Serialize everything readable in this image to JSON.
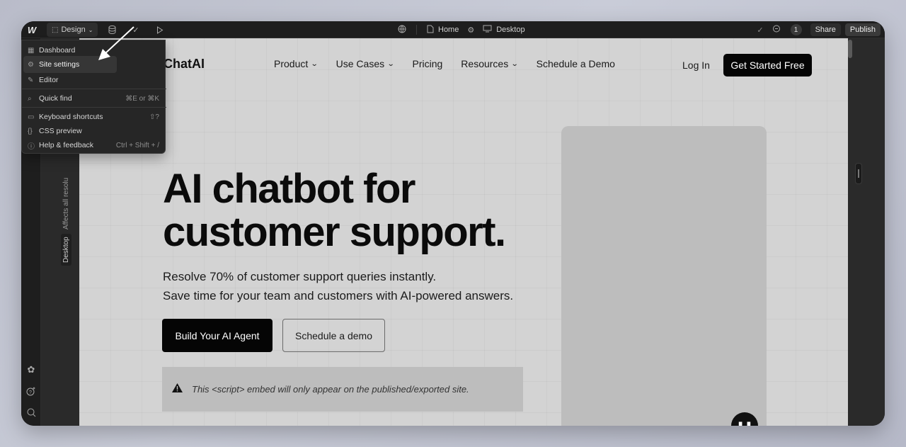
{
  "toolbar": {
    "logo": "W",
    "design_label": "Design",
    "page_label": "Home",
    "breakpoint_label": "Desktop",
    "comment_count": "1",
    "share_label": "Share",
    "publish_label": "Publish"
  },
  "menu": {
    "items": [
      {
        "label": "Dashboard",
        "icon": "grid-icon",
        "shortcut": ""
      },
      {
        "label": "Site settings",
        "icon": "gear-icon",
        "shortcut": ""
      },
      {
        "label": "Editor",
        "icon": "pencil-icon",
        "shortcut": ""
      },
      {
        "label": "Quick find",
        "icon": "search-icon",
        "shortcut": "⌘E or ⌘K"
      },
      {
        "label": "Keyboard shortcuts",
        "icon": "keyboard-icon",
        "shortcut": "⇧?"
      },
      {
        "label": "CSS preview",
        "icon": "braces-icon",
        "shortcut": ""
      },
      {
        "label": "Help & feedback",
        "icon": "help-icon",
        "shortcut": "Ctrl + Shift + /"
      }
    ]
  },
  "breakpoint_strip": {
    "affects_text": "Affects all resolu",
    "desktop_label": "Desktop"
  },
  "site": {
    "brand": "ChatAI",
    "nav": [
      {
        "label": "Product",
        "has_dropdown": true
      },
      {
        "label": "Use Cases",
        "has_dropdown": true
      },
      {
        "label": "Pricing",
        "has_dropdown": false
      },
      {
        "label": "Resources",
        "has_dropdown": true
      },
      {
        "label": "Schedule a Demo",
        "has_dropdown": false
      }
    ],
    "login_label": "Log In",
    "cta_label": "Get Started Free",
    "hero_title_line1": "AI chatbot for",
    "hero_title_line2": "customer support.",
    "hero_sub_line1": "Resolve 70% of customer support queries instantly.",
    "hero_sub_line2": "Save time for your team and customers with AI-powered answers.",
    "primary_button": "Build Your AI Agent",
    "secondary_button": "Schedule a demo",
    "embed_notice": "This <script> embed will only appear on the published/exported site."
  },
  "colors": {
    "editor_bg": "#1e1e1e",
    "canvas_bg": "#d3d3d3",
    "button_black": "#050505",
    "arrow_annotation": "#ffffff"
  }
}
